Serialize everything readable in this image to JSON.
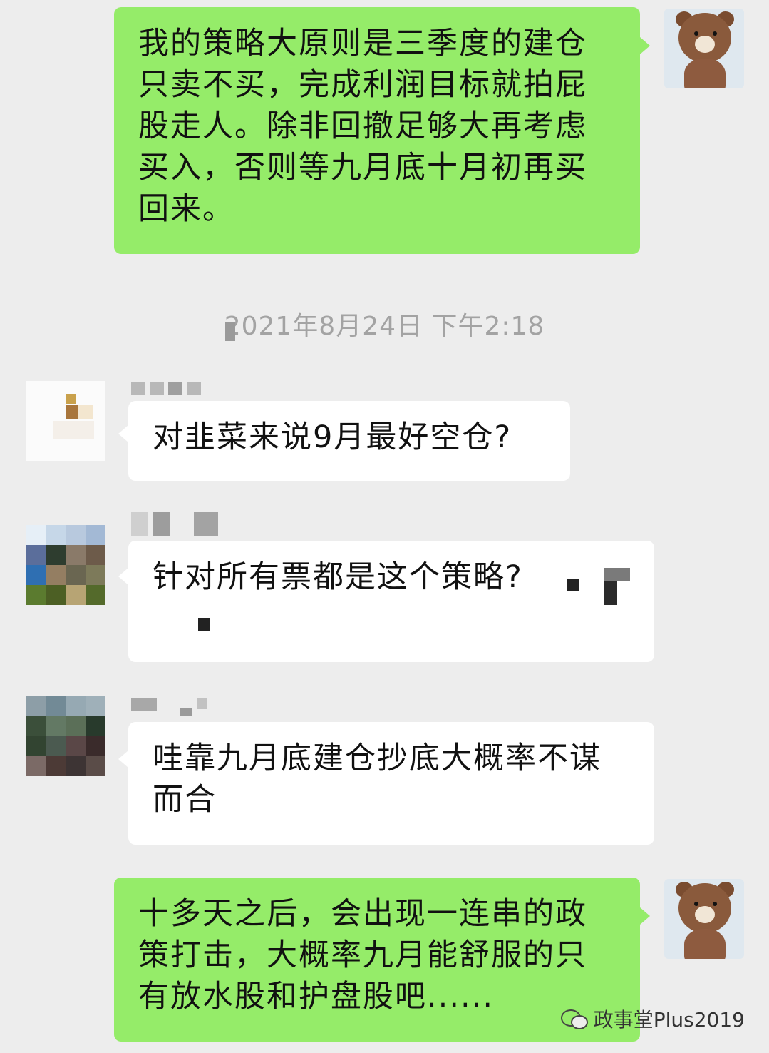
{
  "messages": [
    {
      "sender": "self",
      "text": "我的策略大原则是三季度的建仓只卖不买，完成利润目标就拍屁股走人。除非回撤足够大再考虑买入，否则等九月底十月初再买回来。"
    },
    {
      "sender": "other",
      "text": "对韭菜来说9月最好空仓?"
    },
    {
      "sender": "other",
      "text": "针对所有票都是这个策略?"
    },
    {
      "sender": "other",
      "text": "哇靠九月底建仓抄底大概率不谋而合"
    },
    {
      "sender": "self",
      "text": "十多天之后，会出现一连串的政策打击，大概率九月能舒服的只有放水股和护盘股吧......"
    }
  ],
  "timestamp": "2021年8月24日 下午2:18",
  "watermark": "政事堂Plus2019",
  "icons": {
    "self_avatar": "bear-avatar-icon",
    "other_avatar": "pixelated-avatar-icon",
    "watermark": "wechat-icon"
  },
  "colors": {
    "background": "#ededed",
    "self_bubble": "#95ec69",
    "other_bubble": "#ffffff",
    "timestamp": "#a3a3a3"
  }
}
